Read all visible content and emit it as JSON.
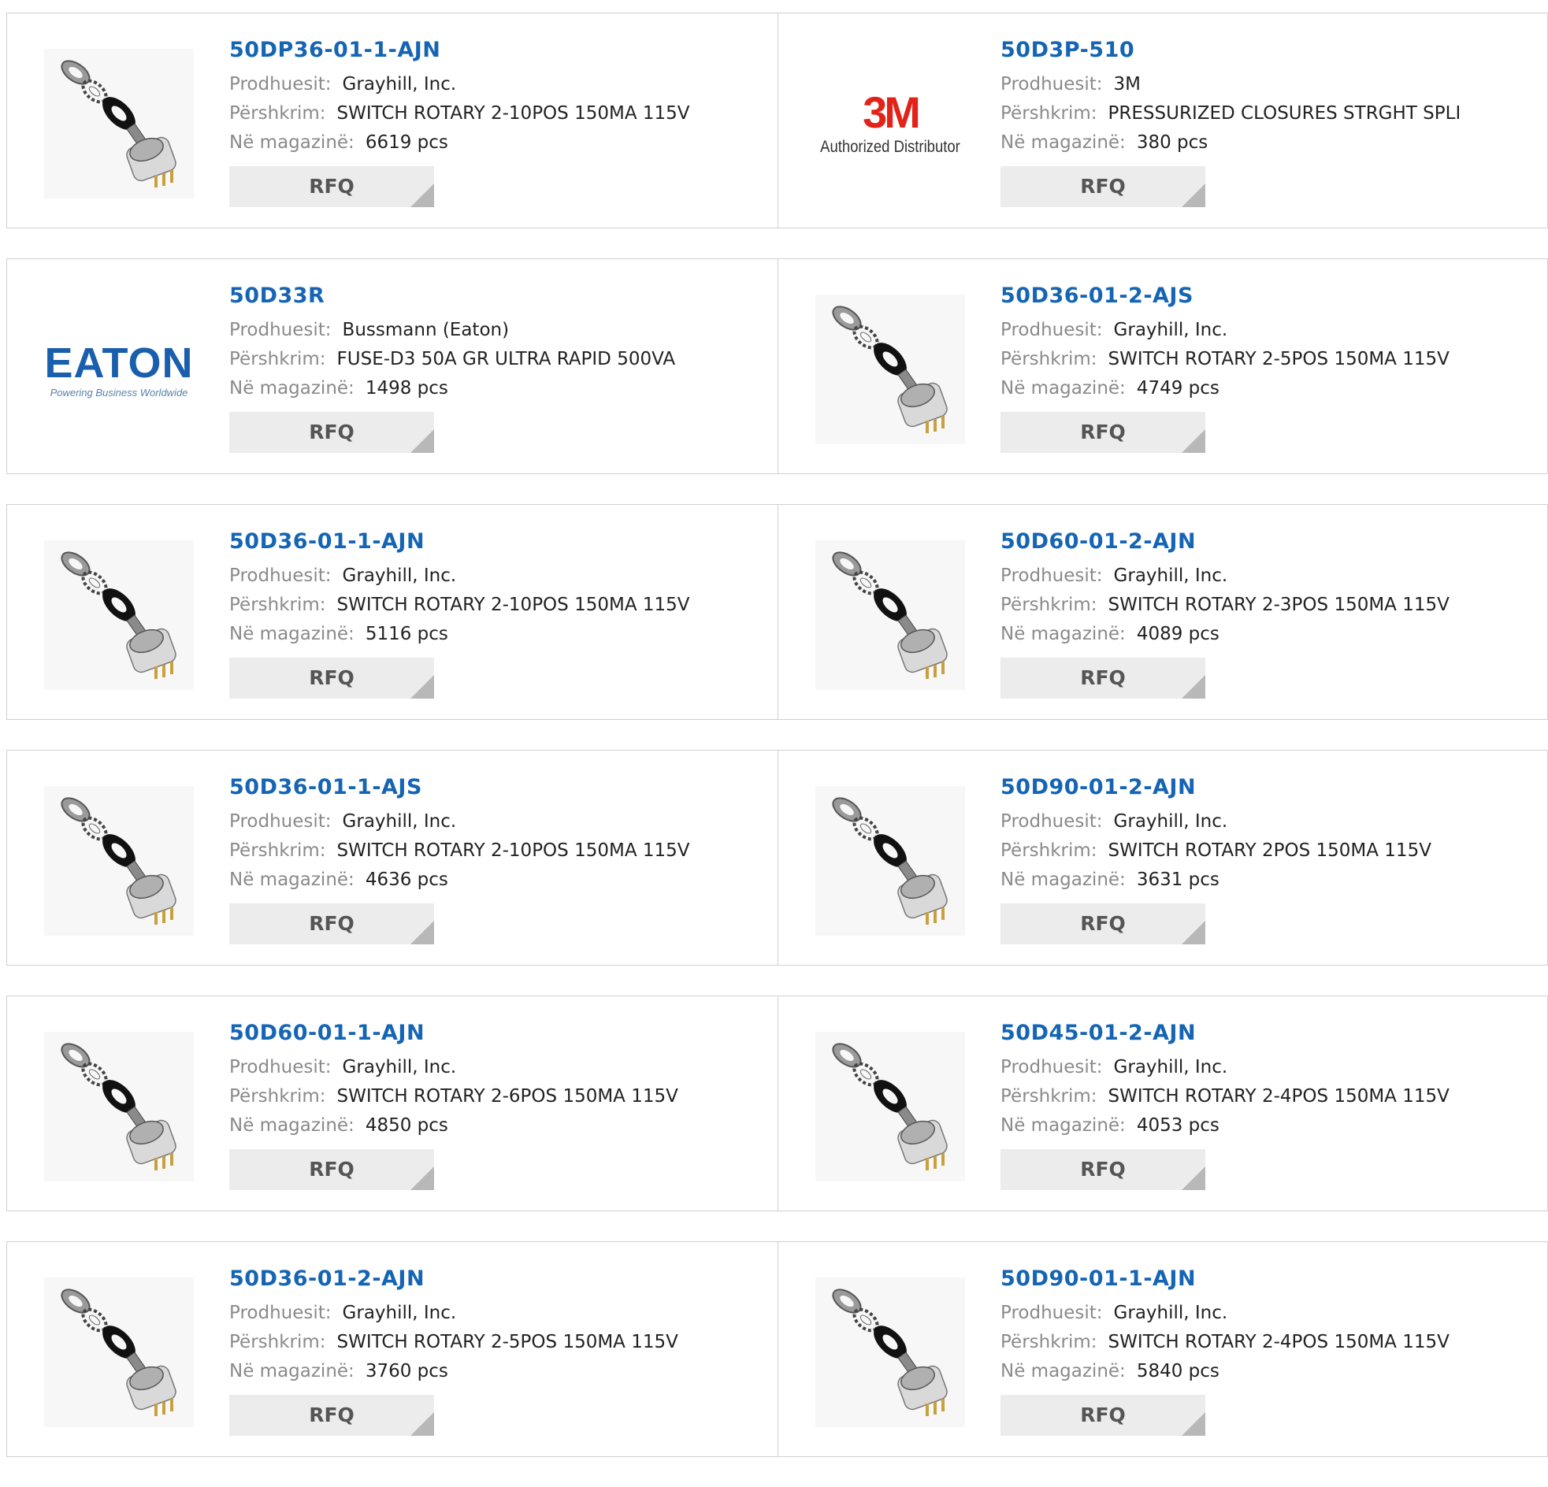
{
  "labels": {
    "manufacturer": "Prodhuesit:",
    "description": "Përshkrim:",
    "stock": "Në magazinë:",
    "rfq": "RFQ"
  },
  "colors": {
    "part_number": "#1565b4",
    "label": "#8a8a8a",
    "rfq_bg": "#ececec"
  },
  "products": [
    {
      "pn": "50DP36-01-1-AJN",
      "manufacturer": "Grayhill, Inc.",
      "description": "SWITCH ROTARY 2-10POS 150MA 115V",
      "stock": "6619 pcs",
      "image": "rotary-switch-icon"
    },
    {
      "pn": "50D3P-510",
      "manufacturer": "3M",
      "description": "PRESSURIZED CLOSURES STRGHT SPLI",
      "stock": "380 pcs",
      "image": "3m-logo",
      "logo_text": "3M",
      "logo_sub": "Authorized Distributor"
    },
    {
      "pn": "50D33R",
      "manufacturer": "Bussmann (Eaton)",
      "description": "FUSE-D3 50A GR ULTRA RAPID 500VA",
      "stock": "1498 pcs",
      "image": "eaton-logo",
      "logo_text": "EATON",
      "logo_sub": "Powering Business Worldwide"
    },
    {
      "pn": "50D36-01-2-AJS",
      "manufacturer": "Grayhill, Inc.",
      "description": "SWITCH ROTARY 2-5POS 150MA 115V",
      "stock": "4749 pcs",
      "image": "rotary-switch-icon"
    },
    {
      "pn": "50D36-01-1-AJN",
      "manufacturer": "Grayhill, Inc.",
      "description": "SWITCH ROTARY 2-10POS 150MA 115V",
      "stock": "5116 pcs",
      "image": "rotary-switch-icon"
    },
    {
      "pn": "50D60-01-2-AJN",
      "manufacturer": "Grayhill, Inc.",
      "description": "SWITCH ROTARY 2-3POS 150MA 115V",
      "stock": "4089 pcs",
      "image": "rotary-switch-icon"
    },
    {
      "pn": "50D36-01-1-AJS",
      "manufacturer": "Grayhill, Inc.",
      "description": "SWITCH ROTARY 2-10POS 150MA 115V",
      "stock": "4636 pcs",
      "image": "rotary-switch-icon"
    },
    {
      "pn": "50D90-01-2-AJN",
      "manufacturer": "Grayhill, Inc.",
      "description": "SWITCH ROTARY 2POS 150MA 115V",
      "stock": "3631 pcs",
      "image": "rotary-switch-icon"
    },
    {
      "pn": "50D60-01-1-AJN",
      "manufacturer": "Grayhill, Inc.",
      "description": "SWITCH ROTARY 2-6POS 150MA 115V",
      "stock": "4850 pcs",
      "image": "rotary-switch-icon"
    },
    {
      "pn": "50D45-01-2-AJN",
      "manufacturer": "Grayhill, Inc.",
      "description": "SWITCH ROTARY 2-4POS 150MA 115V",
      "stock": "4053 pcs",
      "image": "rotary-switch-icon"
    },
    {
      "pn": "50D36-01-2-AJN",
      "manufacturer": "Grayhill, Inc.",
      "description": "SWITCH ROTARY 2-5POS 150MA 115V",
      "stock": "3760 pcs",
      "image": "rotary-switch-icon"
    },
    {
      "pn": "50D90-01-1-AJN",
      "manufacturer": "Grayhill, Inc.",
      "description": "SWITCH ROTARY 2-4POS 150MA 115V",
      "stock": "5840 pcs",
      "image": "rotary-switch-icon"
    }
  ]
}
